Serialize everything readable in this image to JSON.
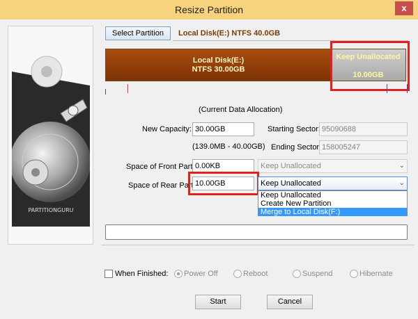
{
  "window": {
    "title": "Resize Partition",
    "close_label": "x"
  },
  "top": {
    "select_partition_label": "Select Partition",
    "disk_label": "Local Disk(E:) NTFS 40.0GB"
  },
  "partition_bar": {
    "used_name": "Local Disk(E:)",
    "used_size": "NTFS 30.00GB",
    "free_label": "Keep Unallocated",
    "free_size": "10.00GB",
    "used_fraction": 0.75
  },
  "allocation_caption": "(Current Data Allocation)",
  "fields": {
    "new_capacity_label": "New Capacity:",
    "new_capacity_value": "30.00GB",
    "capacity_range": "(139.0MB - 40.00GB)",
    "starting_sector_label": "Starting Sector:",
    "starting_sector_value": "95090688",
    "ending_sector_label": "Ending Sector:",
    "ending_sector_value": "158005247",
    "front_space_label": "Space of Front Part:",
    "front_space_value": "0.00KB",
    "front_combo_value": "Keep Unallocated",
    "rear_space_label": "Space of Rear Part:",
    "rear_space_value": "10.00GB",
    "rear_combo_value": "Keep Unallocated"
  },
  "rear_dropdown_options": [
    "Keep Unallocated",
    "Create New Partition",
    "Merge to Local Disk(F:)"
  ],
  "finish_options": {
    "checkbox_label": "When Finished:",
    "power_off": "Power Off",
    "reboot": "Reboot",
    "suspend": "Suspend",
    "hibernate": "Hibernate",
    "selected": "Power Off"
  },
  "buttons": {
    "start": "Start",
    "cancel": "Cancel"
  },
  "logo_text": "PARTITIONGURU",
  "colors": {
    "titlebar": "#f6d37c",
    "used_bar": "#8f3d08",
    "highlight_box": "#e32020",
    "selected_option": "#3399ff"
  }
}
